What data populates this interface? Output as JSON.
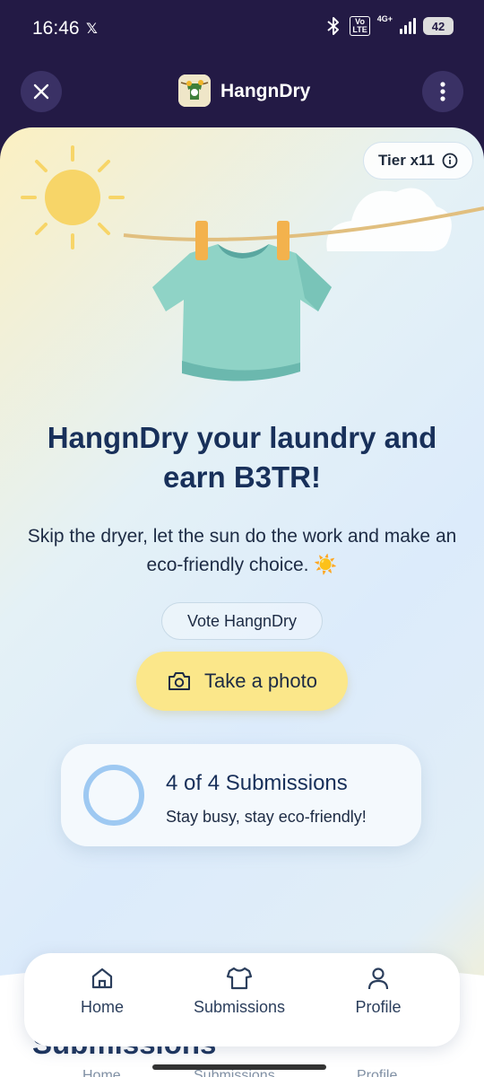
{
  "status_bar": {
    "time": "16:46",
    "x_app": "𝕏",
    "volte": "Vo\nLTE",
    "network": "4G+",
    "battery": "42"
  },
  "header": {
    "title": "HangnDry",
    "close_icon": "close-icon",
    "menu_icon": "more-vertical-icon"
  },
  "hero": {
    "tier_label": "Tier x11",
    "headline": "HangnDry your laundry and earn B3TR!",
    "subtext": "Skip the dryer, let the sun do the work and make an eco-friendly choice. ☀️",
    "vote_label": "Vote HangnDry",
    "photo_label": "Take a photo"
  },
  "progress": {
    "title": "4 of 4 Submissions",
    "subtitle": "Stay busy, stay eco-friendly!",
    "completed": 4,
    "total": 4
  },
  "nav": {
    "items": [
      {
        "label": "Home",
        "icon": "home-icon"
      },
      {
        "label": "Submissions",
        "icon": "shirt-icon"
      },
      {
        "label": "Profile",
        "icon": "user-icon"
      }
    ]
  },
  "section": {
    "title": "Submissions"
  },
  "colors": {
    "header_bg": "#231a45",
    "accent_yellow": "#fbe78a",
    "headline": "#18305a",
    "ring": "#9ec9f2"
  }
}
